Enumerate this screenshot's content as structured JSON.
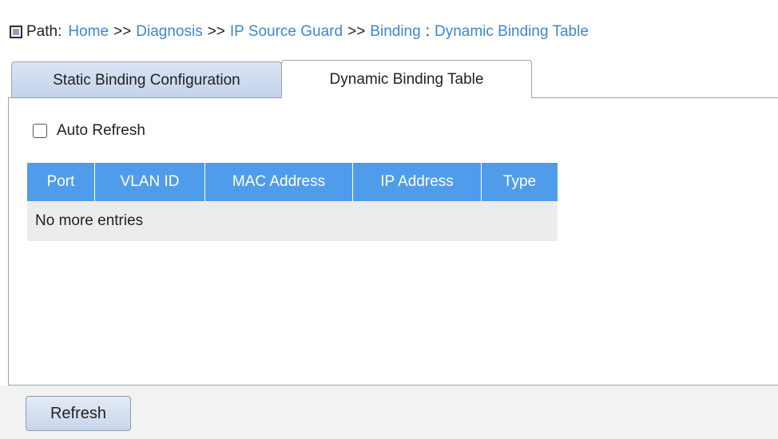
{
  "path": {
    "label": "Path:",
    "crumbs": [
      "Home",
      "Diagnosis",
      "IP Source Guard",
      "Binding"
    ],
    "separator": ">>",
    "colon": ":",
    "current": "Dynamic Binding Table"
  },
  "tabs": [
    {
      "label": "Static Binding Configuration",
      "active": false
    },
    {
      "label": "Dynamic Binding Table",
      "active": true
    }
  ],
  "auto_refresh": {
    "label": "Auto Refresh",
    "checked": false
  },
  "table": {
    "columns": [
      "Port",
      "VLAN ID",
      "MAC Address",
      "IP Address",
      "Type"
    ],
    "empty_message": "No more entries"
  },
  "buttons": {
    "refresh": "Refresh"
  },
  "colors": {
    "link": "#3e86d0",
    "header_bg": "#4f9dea",
    "row_bg": "#ececec",
    "tab_inactive_bg": "#c4d2ea"
  }
}
